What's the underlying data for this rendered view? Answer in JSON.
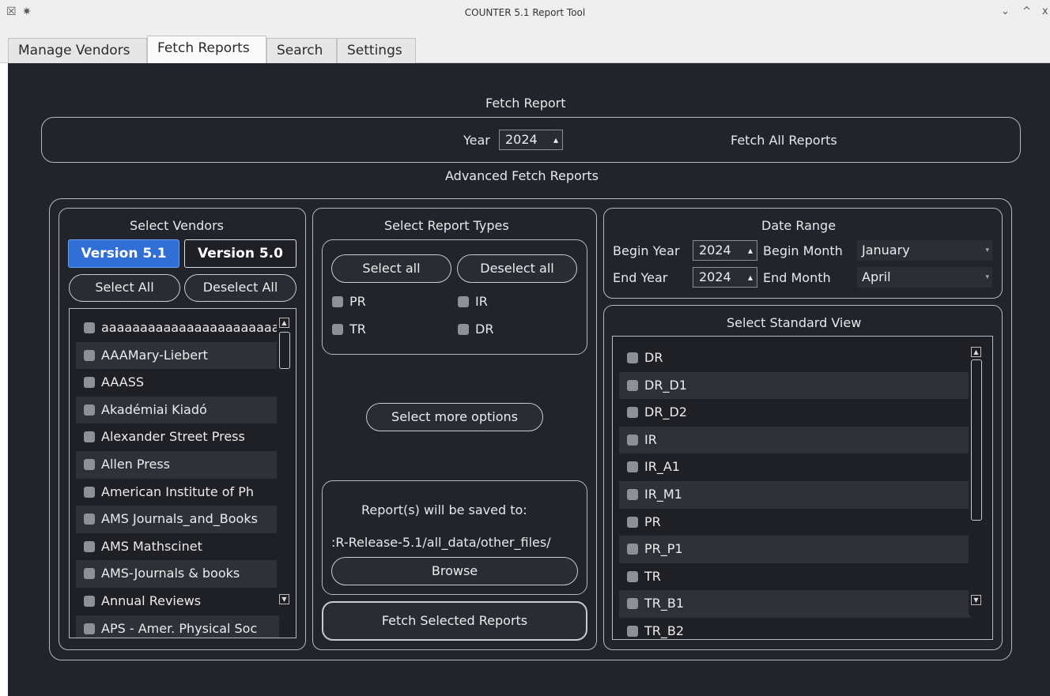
{
  "window": {
    "title": "COUNTER 5.1 Report Tool",
    "controls": [
      "⌄",
      "^",
      "x"
    ]
  },
  "tabs": [
    {
      "label": "Manage Vendors"
    },
    {
      "label": "Fetch Reports"
    },
    {
      "label": "Search"
    },
    {
      "label": "Settings"
    }
  ],
  "fetch_report": {
    "heading": "Fetch Report",
    "year_label": "Year",
    "year_value": "2024",
    "fetch_all_label": "Fetch All Reports"
  },
  "advanced": {
    "heading": "Advanced Fetch Reports",
    "vendors": {
      "heading": "Select Vendors",
      "version_51": "Version 5.1",
      "version_50": "Version 5.0",
      "select_all": "Select All",
      "deselect_all": "Deselect All",
      "items": [
        "aaaaaaaaaaaaaaaaaaaaaaa",
        "AAAMary-Liebert",
        "AAASS",
        "Akadémiai Kiadó",
        "Alexander Street Press",
        "Allen Press",
        "American Institute of Ph",
        "AMS Journals_and_Books",
        "AMS Mathscinet",
        "AMS-Journals & books",
        "Annual Reviews",
        "APS - Amer. Physical Soc"
      ]
    },
    "report_types": {
      "heading": "Select Report Types",
      "select_all": "Select all",
      "deselect_all": "Deselect all",
      "types": [
        "PR",
        "IR",
        "TR",
        "DR"
      ],
      "more_options": "Select more options",
      "save_to_label": "Report(s) will be saved to:",
      "save_path": ":R-Release-5.1/all_data/other_files/",
      "browse": "Browse",
      "fetch_selected": "Fetch Selected Reports"
    },
    "date_range": {
      "heading": "Date Range",
      "begin_year_label": "Begin Year",
      "begin_year": "2024",
      "begin_month_label": "Begin Month",
      "begin_month": "January",
      "end_year_label": "End Year",
      "end_year": "2024",
      "end_month_label": "End Month",
      "end_month": "April"
    },
    "standard_view": {
      "heading": "Select Standard View",
      "items": [
        "DR",
        "DR_D1",
        "DR_D2",
        "IR",
        "IR_A1",
        "IR_M1",
        "PR",
        "PR_P1",
        "TR",
        "TR_B1",
        "TR_B2"
      ]
    }
  }
}
